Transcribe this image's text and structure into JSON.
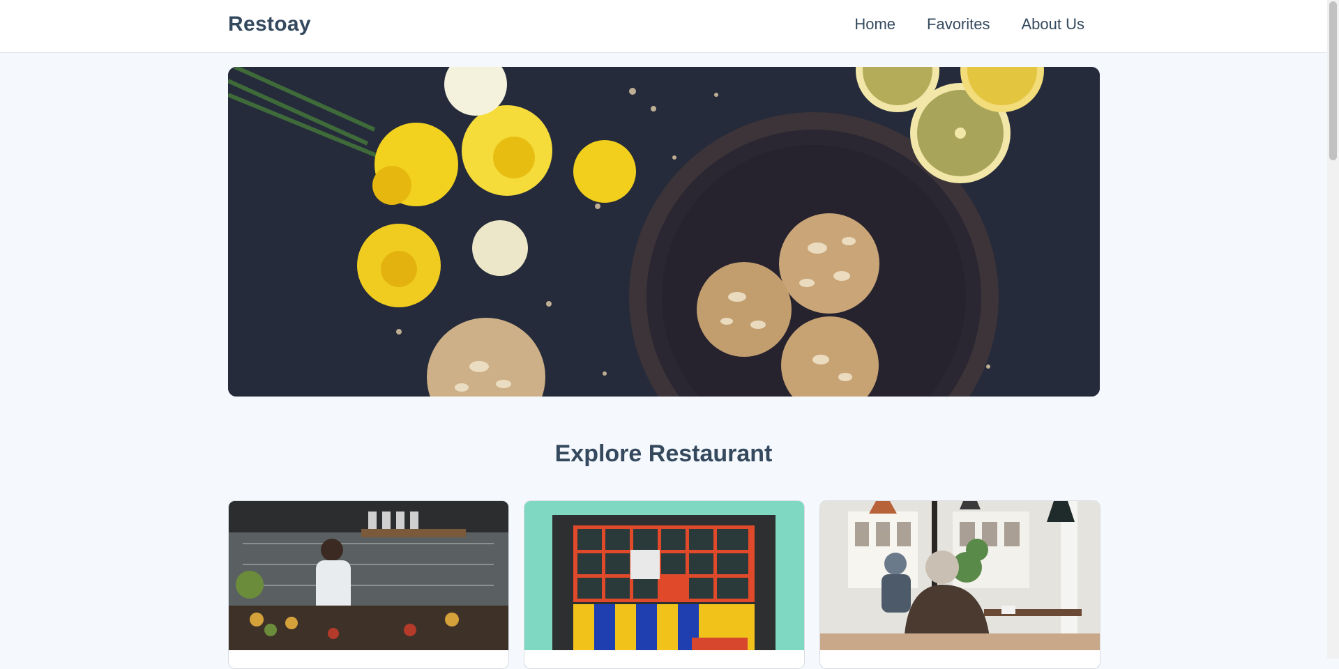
{
  "navbar": {
    "brand": "Restoay",
    "links": [
      {
        "label": "Home"
      },
      {
        "label": "Favorites"
      },
      {
        "label": "About Us"
      }
    ]
  },
  "hero": {
    "image": "hero-food-photo"
  },
  "explore": {
    "title": "Explore Restaurant"
  },
  "restaurants": [
    {
      "image": "cafe-counter-photo"
    },
    {
      "image": "shopfront-window-photo"
    },
    {
      "image": "cafe-interior-photo"
    }
  ],
  "colors": {
    "heading": "#34495e",
    "background": "#f5f8fc",
    "hero_bg": "#262c3c"
  }
}
